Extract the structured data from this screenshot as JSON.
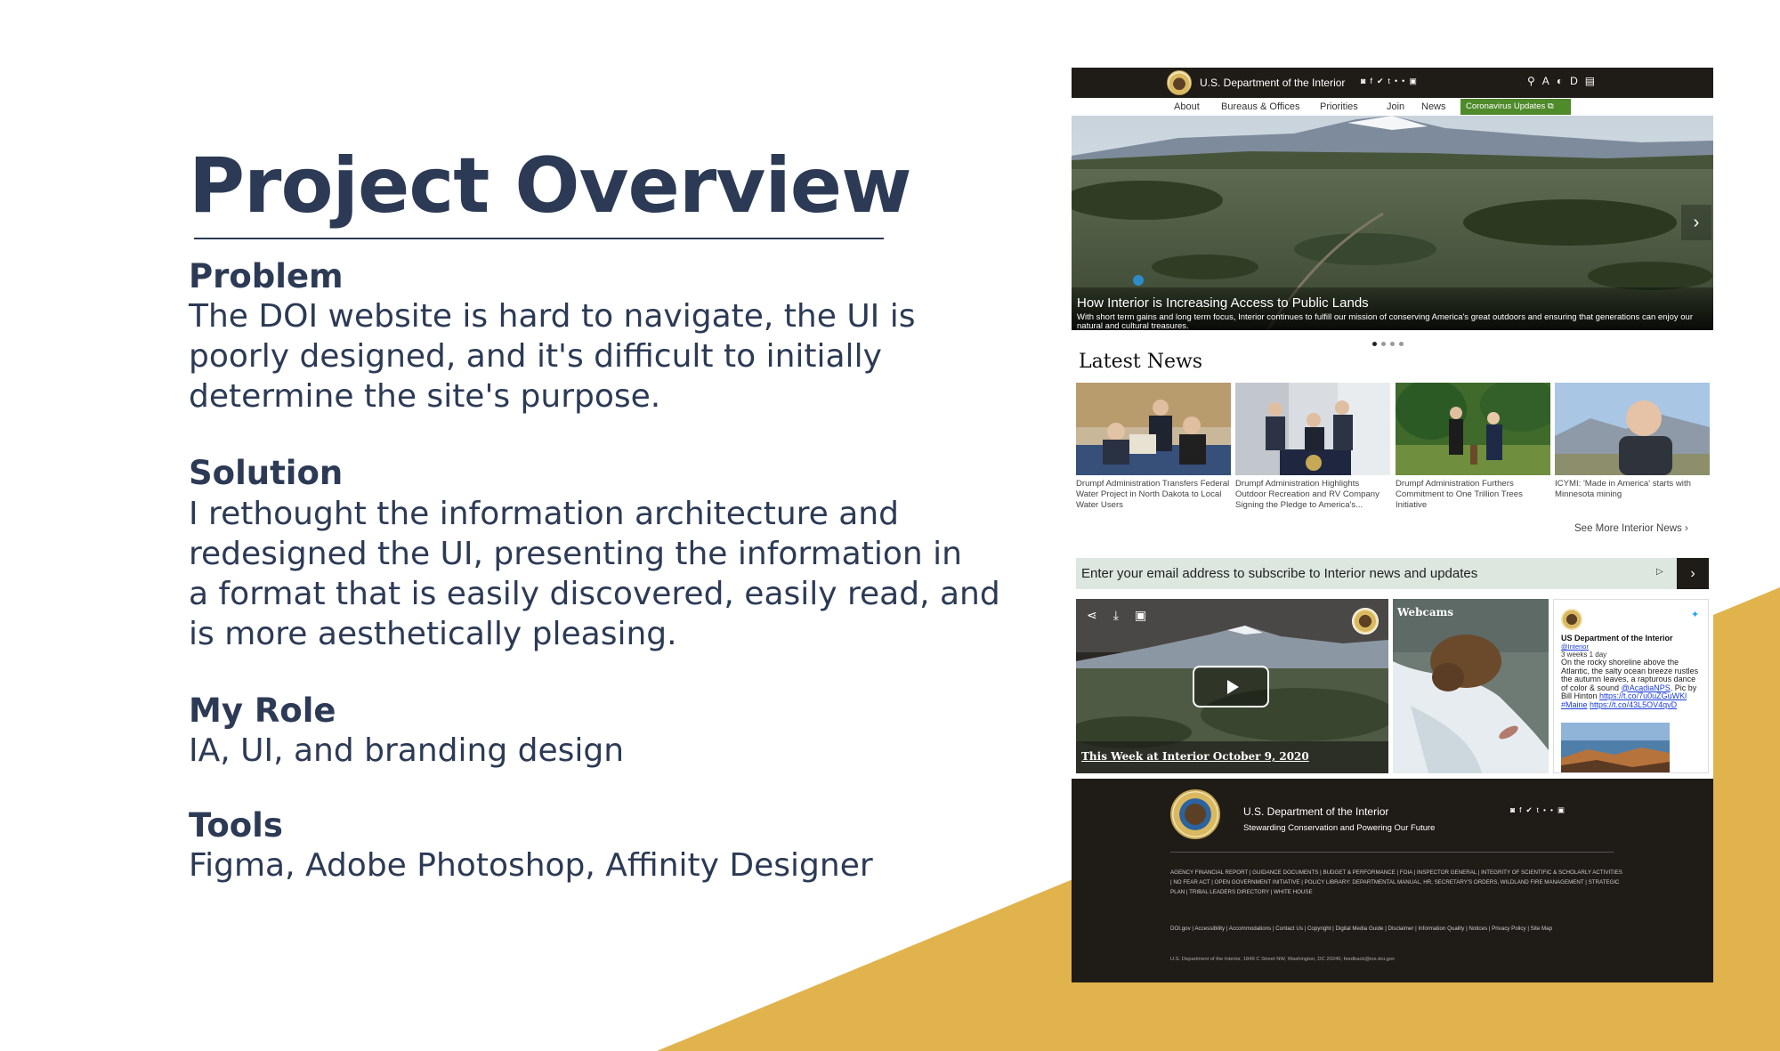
{
  "colors": {
    "navy": "#2c3a55",
    "gold": "#e1b34c",
    "doi_dark": "#1f1b17",
    "corona_green": "#4f8a2b"
  },
  "overview": {
    "title": "Project Overview",
    "problem_heading": "Problem",
    "problem_lines": [
      "The DOI website is hard to navigate, the UI is",
      "poorly designed, and it's difficult to initially",
      "determine the site's purpose."
    ],
    "solution_heading": "Solution",
    "solution_lines": [
      "I rethought the information architecture and",
      "redesigned the UI, presenting the information in",
      "a format that is easily discovered, easily read, and",
      "is more aesthetically pleasing."
    ],
    "role_heading": "My Role",
    "role_text": "IA, UI, and branding design",
    "tools_heading": "Tools",
    "tools_text": "Figma, Adobe Photoshop, Affinity Designer"
  },
  "site": {
    "header": {
      "title": "U.S. Department of the Interior",
      "social_icons": [
        "instagram-icon",
        "facebook-icon",
        "twitter-icon",
        "tumblr-icon",
        "flickr-icon",
        "youtube-icon"
      ],
      "tool_icons": [
        "search-icon",
        "text-size-icon",
        "contrast-icon",
        "dyslexia-font-icon",
        "keyboard-icon"
      ]
    },
    "nav": {
      "items": [
        "About",
        "Bureaus & Offices",
        "Priorities",
        "Join",
        "News"
      ],
      "corona_label": "Coronavirus Updates"
    },
    "hero": {
      "title": "How Interior is Increasing Access to Public Lands",
      "subtitle": "With short term gains and long term focus, Interior continues to fulfill our mission of conserving America's great outdoors and ensuring that generations can enjoy our natural and cultural treasures.",
      "slide_count": 4,
      "active_slide": 1
    },
    "latest_news": {
      "heading": "Latest News",
      "items": [
        "Drumpf Administration Transfers Federal Water Project in North Dakota to Local Water Users",
        "Drumpf Administration Highlights Outdoor Recreation and RV Company Signing the Pledge to America's...",
        "Drumpf Administration Furthers Commitment to One Trillion Trees Initiative",
        "ICYMI: 'Made in America' starts with Minnesota mining"
      ],
      "see_more": "See More Interior News"
    },
    "subscribe": {
      "placeholder": "Enter your email address to subscribe to Interior news and updates"
    },
    "video": {
      "title": "This Week at Interior October 9, 2020"
    },
    "webcam": {
      "label": "Webcams"
    },
    "tweet": {
      "name": "US Department of the Interior",
      "handle": "@Interior",
      "time": "3 weeks 1 day",
      "body": "On the rocky shoreline above the Atlantic, the salty ocean breeze rustles the autumn leaves, a rapturous dance of color & sound",
      "mention": "@AcadiaNPS",
      "credit": ". Pic by Bill Hinton",
      "link1": "https://t.co/7u0uZGuWKl",
      "hashtag": "#Maine",
      "link2": "https://t.co/43L5OV4qvD"
    },
    "footer": {
      "title": "U.S. Department of the Interior",
      "tagline": "Stewarding Conservation and Powering Our Future",
      "links_a": "AGENCY FINANCIAL REPORT  |  GUIDANCE DOCUMENTS  |  BUDGET & PERFORMANCE  |  FOIA  |  INSPECTOR GENERAL  |  INTEGRITY OF SCIENTIFIC & SCHOLARLY ACTIVITIES  |  NO FEAR ACT  |  OPEN GOVERNMENT INITIATIVE  |  POLICY LIBRARY: DEPARTMENTAL MANUAL, HR, SECRETARY'S ORDERS, WILDLAND FIRE MANAGEMENT  |  STRATEGIC PLAN  |  TRIBAL LEADERS DIRECTORY  |  WHITE HOUSE",
      "links_b": "DOI.gov  |  Accessibility  |  Accommodations  |  Contact Us  |  Copyright  |  Digital Media Guide  |  Disclaimer  |  Information Quality  |  Notices  |  Privacy Policy  |  Site Map",
      "address": "U.S. Department of the Interior, 1849 C Street NW, Washington, DC 20240, feedback@ios.doi.gov"
    }
  }
}
